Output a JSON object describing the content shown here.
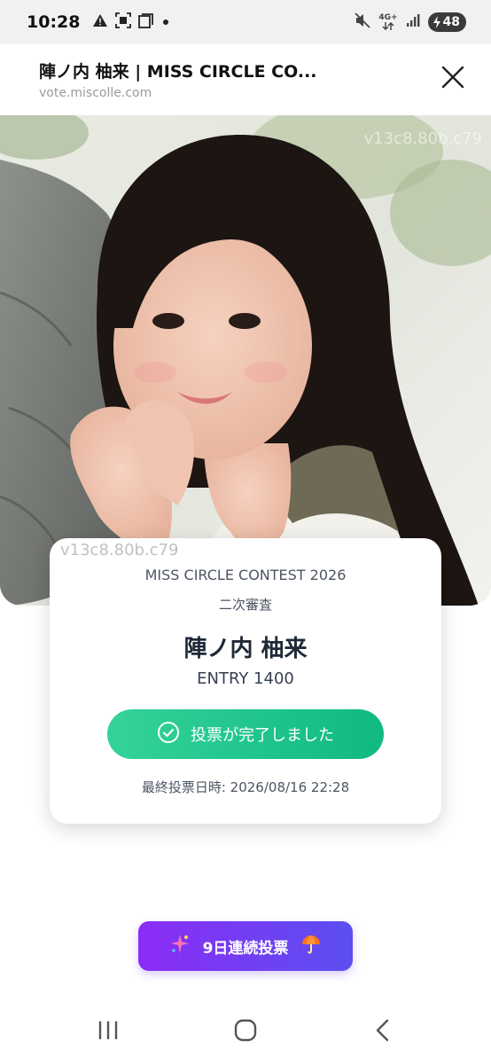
{
  "status_bar": {
    "time": "10:28",
    "network": "4G+",
    "battery": "48",
    "icons": [
      "warning-icon",
      "screenshot-icon",
      "window-icon",
      "dot-icon",
      "mute-icon",
      "network-icon",
      "signal-icon",
      "battery-icon"
    ]
  },
  "browser": {
    "title": "陣ノ内 柚来 | MISS CIRCLE CO...",
    "url": "vote.miscolle.com",
    "close_icon": "close-icon"
  },
  "photo": {
    "watermark": "v13c8.80b.c79"
  },
  "card": {
    "watermark": "v13c8.80b.c79",
    "contest": "MISS CIRCLE CONTEST 2026",
    "round": "二次審査",
    "name": "陣ノ内 柚来",
    "entry": "ENTRY 1400",
    "vote_done_label": "投票が完了しました",
    "last_vote": "最終投票日時: 2026/08/16 22:28"
  },
  "streak": {
    "label": "9日連続投票"
  },
  "nav": {
    "icons": [
      "recents-icon",
      "home-icon",
      "back-icon"
    ]
  },
  "colors": {
    "vote_button": "#10b981",
    "streak_start": "#8b2cf5",
    "streak_end": "#5b4ff0"
  }
}
